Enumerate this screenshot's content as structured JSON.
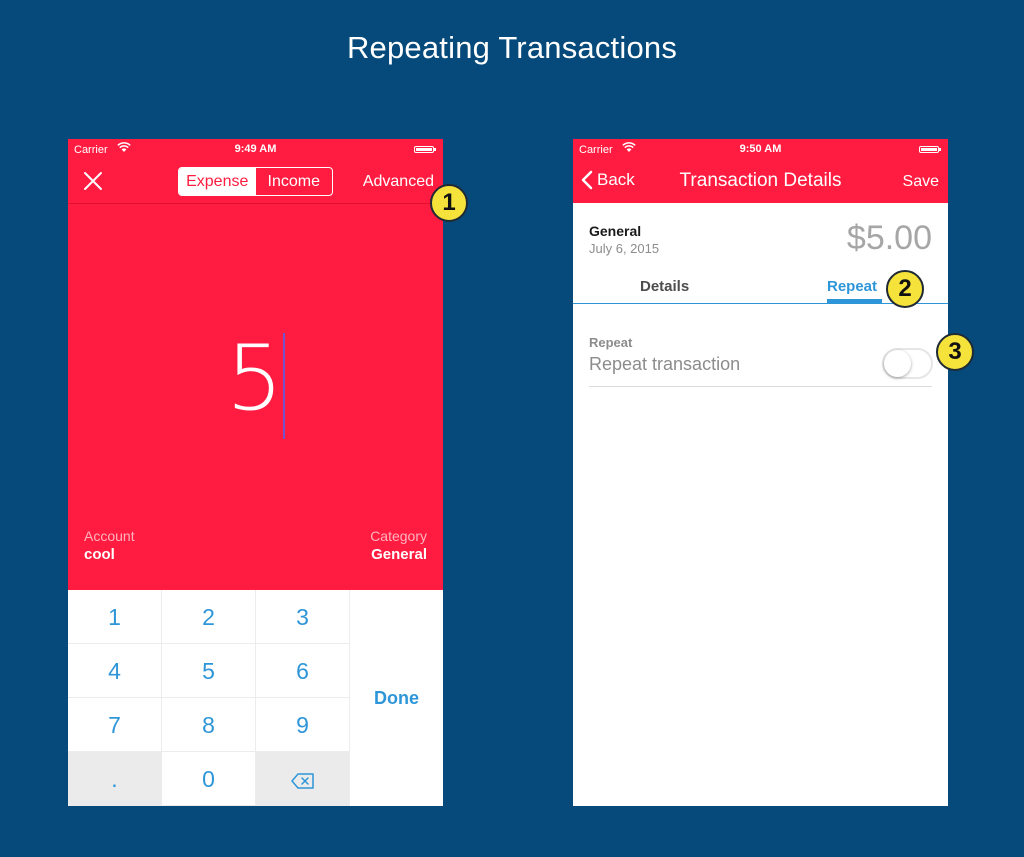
{
  "page": {
    "title": "Repeating Transactions"
  },
  "left_phone": {
    "status": {
      "carrier": "Carrier",
      "time": "9:49 AM"
    },
    "nav": {
      "segments": [
        "Expense",
        "Income"
      ],
      "active_segment": "Expense",
      "advanced_label": "Advanced"
    },
    "amount_input": "5",
    "account": {
      "label": "Account",
      "value": "cool"
    },
    "category": {
      "label": "Category",
      "value": "General"
    },
    "keypad": {
      "keys": [
        "1",
        "2",
        "3",
        "4",
        "5",
        "6",
        "7",
        "8",
        "9",
        ".",
        "0"
      ],
      "done_label": "Done"
    }
  },
  "right_phone": {
    "status": {
      "carrier": "Carrier",
      "time": "9:50 AM"
    },
    "nav": {
      "back_label": "Back",
      "title": "Transaction Details",
      "save_label": "Save"
    },
    "transaction": {
      "category": "General",
      "date": "July 6, 2015",
      "amount": "$5.00"
    },
    "tabs": [
      "Details",
      "Repeat"
    ],
    "active_tab": "Repeat",
    "repeat_section": {
      "label": "Repeat",
      "row_text": "Repeat transaction",
      "toggle_on": false
    }
  },
  "callouts": [
    "1",
    "2",
    "3"
  ],
  "colors": {
    "background": "#054a7a",
    "accent_red": "#ff1c40",
    "accent_blue": "#2e96d8",
    "callout_yellow": "#f5e23a"
  },
  "icons": [
    "wifi-icon",
    "battery-icon",
    "close-icon",
    "chevron-left-icon",
    "backspace-icon"
  ]
}
